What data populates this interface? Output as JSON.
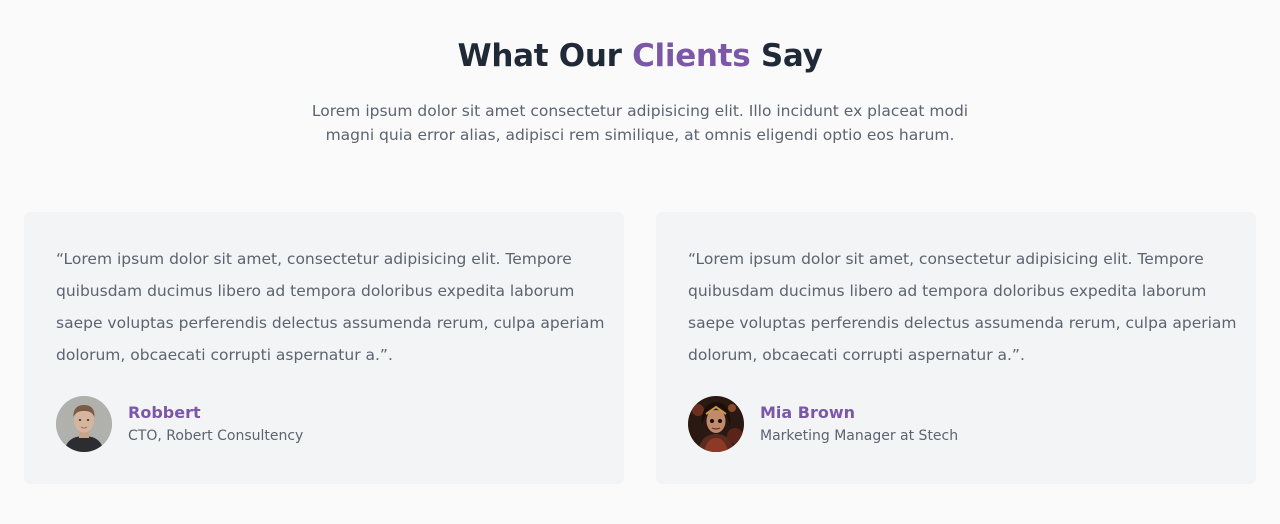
{
  "header": {
    "title_prefix": "What Our",
    "title_accent": "Clients",
    "title_suffix": "Say",
    "intro": "Lorem ipsum dolor sit amet consectetur adipisicing elit. Illo incidunt ex placeat modi magni quia error alias, adipisci rem similique, at omnis eligendi optio eos harum."
  },
  "colors": {
    "accent": "#7c57a8",
    "heading": "#1f2937",
    "body_text": "#5b6470",
    "card_bg": "#f3f4f6",
    "page_bg": "#fafafb"
  },
  "testimonials": [
    {
      "quote": "“Lorem ipsum dolor sit amet, consectetur adipisicing elit. Tempore quibusdam ducimus libero ad tempora doloribus expedita laborum saepe voluptas perferendis delectus assumenda rerum, culpa aperiam dolorum, obcaecati corrupti aspernatur a.”.",
      "name": "Robbert",
      "role": "CTO, Robert Consultency",
      "avatar_icon": "person-avatar-photo"
    },
    {
      "quote": "“Lorem ipsum dolor sit amet, consectetur adipisicing elit. Tempore quibusdam ducimus libero ad tempora doloribus expedita laborum saepe voluptas perferendis delectus assumenda rerum, culpa aperiam dolorum, obcaecati corrupti aspernatur a.”.",
      "name": "Mia Brown",
      "role": "Marketing Manager at Stech",
      "avatar_icon": "person-avatar-photo"
    }
  ]
}
